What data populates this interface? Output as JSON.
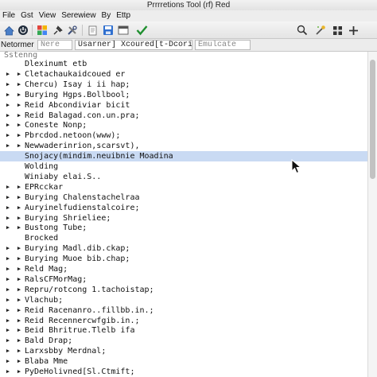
{
  "window": {
    "title": "Prrrretions Tool (rf) Red"
  },
  "menubar": {
    "items": [
      "File",
      "Gst",
      "View",
      "Serewiew",
      "By",
      "Ettp"
    ]
  },
  "toolbar": {
    "icons": [
      "home-icon",
      "power-icon",
      "puzzle-icon",
      "pin-icon",
      "tools-icon",
      "page-icon",
      "save-icon",
      "folder-icon",
      "check-icon",
      "search-icon",
      "wand-icon",
      "grid-icon",
      "add-icon"
    ]
  },
  "address": {
    "label": "Netormer",
    "field1": "Nere",
    "field2": "Usarner] Xcoured[t-Dcorithis",
    "field3": "Emulcate"
  },
  "tree": {
    "header": "Sstenng",
    "items": [
      {
        "label": "Dlexinumt  etb",
        "state": "none"
      },
      {
        "label": "Cletachaukaidcoued er",
        "state": "collapsed"
      },
      {
        "label": "Chercu)  Isay i ii hap;",
        "state": "collapsed"
      },
      {
        "label": "Burying Hgps.Bollbool;",
        "state": "collapsed"
      },
      {
        "label": "Reid Abcondiviar bicit",
        "state": "collapsed"
      },
      {
        "label": "Reid Balagad.con.un.pra;",
        "state": "collapsed"
      },
      {
        "label": "Coneste Nonp;",
        "state": "collapsed"
      },
      {
        "label": "Pbrcdod.netoon(www);",
        "state": "collapsed"
      },
      {
        "label": "Newwaderinrion,scarsvt),",
        "state": "collapsed"
      },
      {
        "label": "Snojacy(mindim.neuibnie Moadina",
        "state": "none",
        "selected": true
      },
      {
        "label": "Wolding",
        "state": "none"
      },
      {
        "label": "Winiaby elai.S..",
        "state": "none"
      },
      {
        "label": "EPRcckar",
        "state": "collapsed"
      },
      {
        "label": "Burying Chalenstachelraa",
        "state": "collapsed"
      },
      {
        "label": "Auryinelfudienstalcoire;",
        "state": "collapsed"
      },
      {
        "label": "Burying Shrieliee;",
        "state": "collapsed"
      },
      {
        "label": "Bustong Tube;",
        "state": "collapsed"
      },
      {
        "label": "Brocked",
        "state": "none"
      },
      {
        "label": "Burying Madl.dib.ckap;",
        "state": "collapsed"
      },
      {
        "label": "Burying Muoe bib.chap;",
        "state": "collapsed"
      },
      {
        "label": "Reld Mag;",
        "state": "collapsed"
      },
      {
        "label": "RalsCFMorMag;",
        "state": "collapsed"
      },
      {
        "label": "Repru/rotcong 1.tachoistap;",
        "state": "collapsed"
      },
      {
        "label": "Vlachub;",
        "state": "collapsed"
      },
      {
        "label": "Reid Racenanro..fillbb.in.;",
        "state": "collapsed"
      },
      {
        "label": "Reid Recennercwfgib.in.;",
        "state": "collapsed"
      },
      {
        "label": "Beid Bhritrue.Tlelb ifa",
        "state": "collapsed"
      },
      {
        "label": "Bald Drap;",
        "state": "collapsed"
      },
      {
        "label": "Larxsbby Merdnal;",
        "state": "collapsed"
      },
      {
        "label": "Blaba Mme",
        "state": "collapsed"
      },
      {
        "label": "PyDeHolivned[Sl.Ctmift;",
        "state": "collapsed"
      }
    ]
  },
  "colors": {
    "selection": "#c9daf3",
    "tree_bg": "#ffffff",
    "chrome": "#ececec"
  }
}
